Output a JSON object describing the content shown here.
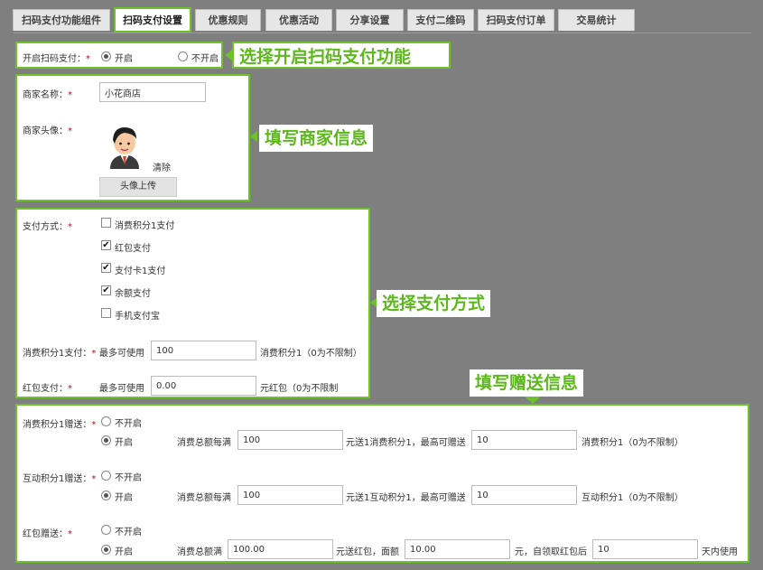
{
  "tabs": [
    {
      "label": "扫码支付功能组件",
      "active": false
    },
    {
      "label": "扫码支付设置",
      "active": true
    },
    {
      "label": "优惠规则",
      "active": false
    },
    {
      "label": "优惠活动",
      "active": false
    },
    {
      "label": "分享设置",
      "active": false
    },
    {
      "label": "支付二维码",
      "active": false
    },
    {
      "label": "扫码支付订单",
      "active": false
    },
    {
      "label": "交易统计",
      "active": false
    }
  ],
  "enable": {
    "label": "开启扫码支付：",
    "required": "*",
    "options": [
      {
        "label": "开启",
        "selected": true
      },
      {
        "label": "不开启",
        "selected": false
      }
    ],
    "callout": "选择开启扫码支付功能"
  },
  "merchant": {
    "name_label": "商家名称：",
    "name_value": "小花商店",
    "avatar_label": "商家头像：",
    "clear_label": "清除",
    "upload_label": "头像上传",
    "required": "*",
    "callout": "填写商家信息"
  },
  "payment": {
    "method_label": "支付方式：",
    "required": "*",
    "methods": [
      {
        "label": "消费积分1支付",
        "checked": false
      },
      {
        "label": "红包支付",
        "checked": true
      },
      {
        "label": "支付卡1支付",
        "checked": true
      },
      {
        "label": "余额支付",
        "checked": true
      },
      {
        "label": "手机支付宝",
        "checked": false
      }
    ],
    "points_label": "消费积分1支付：",
    "points_prefix": "最多可使用",
    "points_value": "100",
    "points_suffix": "消费积分1（0为不限制）",
    "redpack_label": "红包支付：",
    "redpack_prefix": "最多可使用",
    "redpack_value": "0.00",
    "redpack_suffix": "元红包（0为不限制",
    "callout": "选择支付方式"
  },
  "gift": {
    "callout": "填写赠送信息",
    "required": "*",
    "off_label": "不开启",
    "on_label": "开启",
    "rows": [
      {
        "label": "消费积分1赠送：",
        "prefix": "消费总额每满",
        "amount": "100",
        "middle": "元送1消费积分1，最高可赠送",
        "max": "10",
        "suffix": "消费积分1（0为不限制）"
      },
      {
        "label": "互动积分1赠送：",
        "prefix": "消费总额每满",
        "amount": "100",
        "middle": "元送1互动积分1，最高可赠送",
        "max": "10",
        "suffix": "互动积分1（0为不限制）"
      }
    ],
    "redpack": {
      "label": "红包赠送：",
      "prefix": "消费总额满",
      "amount": "100.00",
      "middle": "元送红包，面额",
      "face": "10.00",
      "middle2": "元，自领取红包后",
      "days": "10",
      "suffix": "天内使用"
    }
  },
  "colors": {
    "accent": "#6dc22c",
    "callout_text": "#5cb81c",
    "required": "#d0021b",
    "backdrop": "#7f7f7f"
  }
}
